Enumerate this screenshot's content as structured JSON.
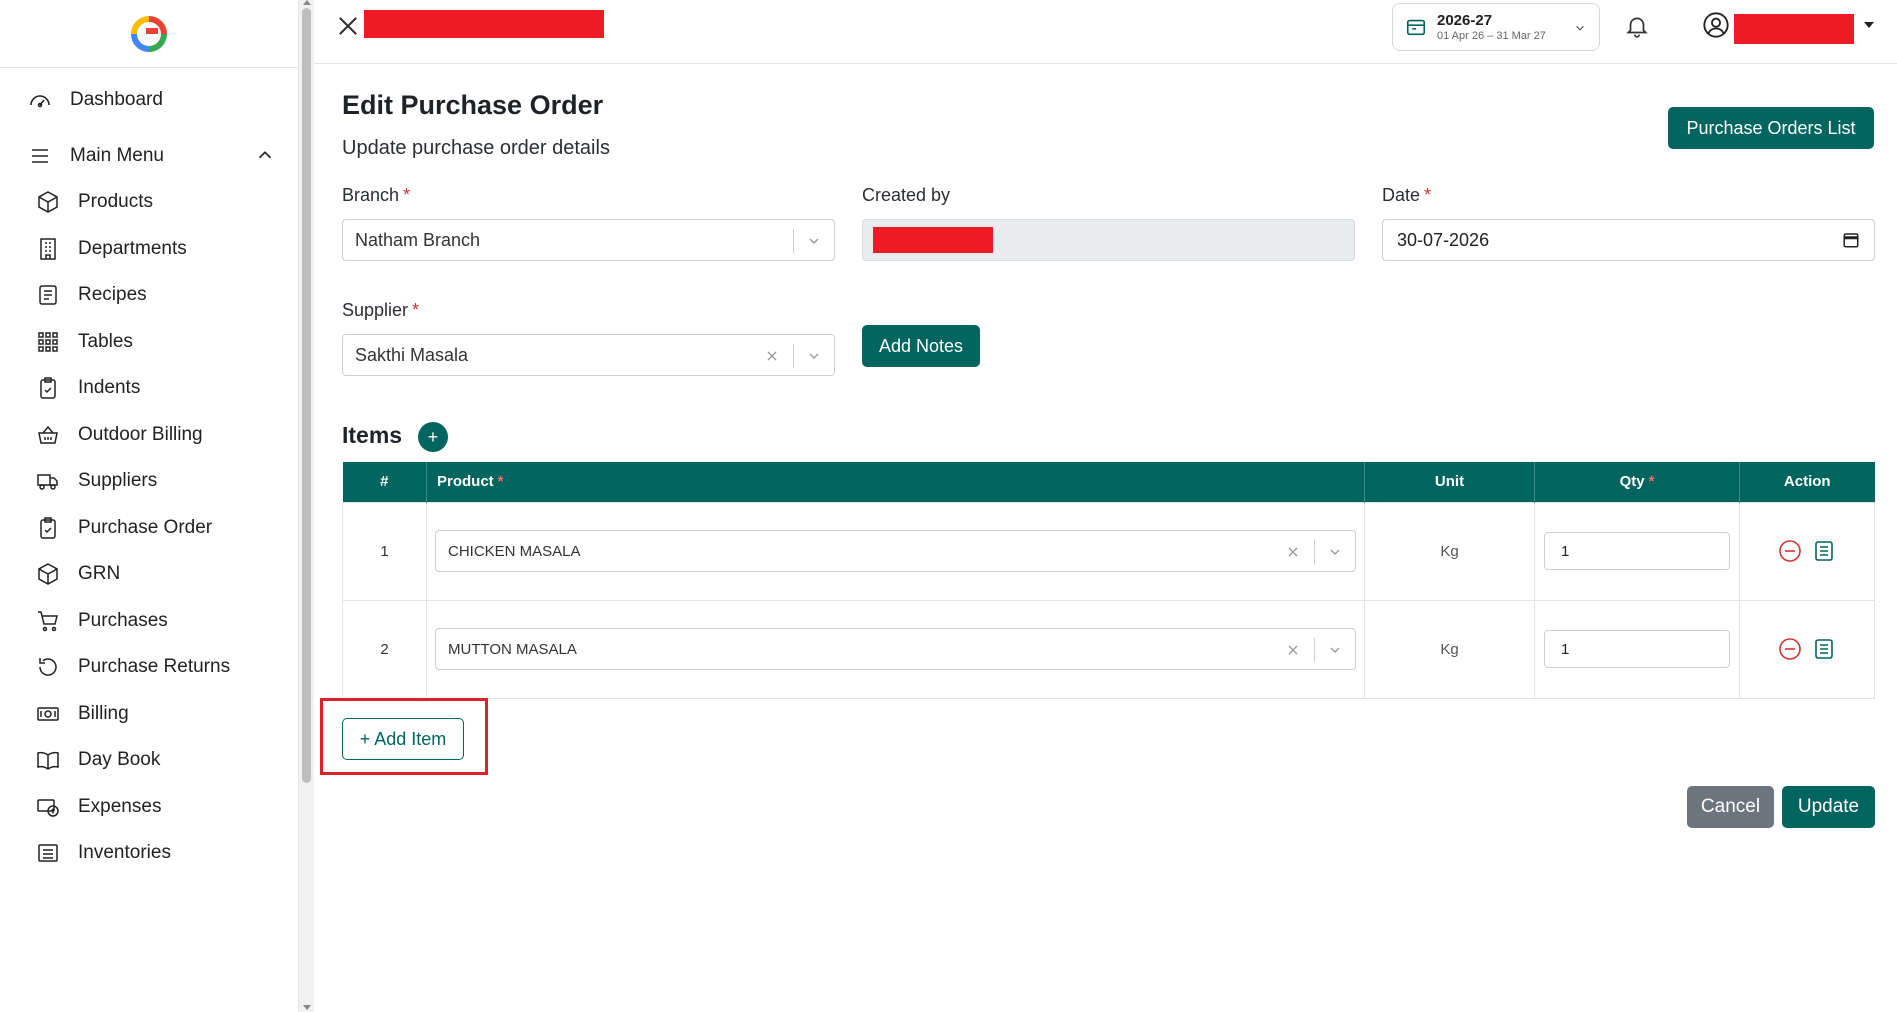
{
  "sidebar": {
    "dashboard": "Dashboard",
    "main_menu": "Main Menu",
    "items": [
      {
        "label": "Products",
        "icon": "box-icon"
      },
      {
        "label": "Departments",
        "icon": "building-icon"
      },
      {
        "label": "Recipes",
        "icon": "recipe-list-icon"
      },
      {
        "label": "Tables",
        "icon": "grid-icon"
      },
      {
        "label": "Indents",
        "icon": "clipboard-check-icon"
      },
      {
        "label": "Outdoor Billing",
        "icon": "basket-icon"
      },
      {
        "label": "Suppliers",
        "icon": "truck-icon"
      },
      {
        "label": "Purchase Order",
        "icon": "clipboard-check-icon"
      },
      {
        "label": "GRN",
        "icon": "box-icon"
      },
      {
        "label": "Purchases",
        "icon": "cart-icon"
      },
      {
        "label": "Purchase Returns",
        "icon": "return-icon"
      },
      {
        "label": "Billing",
        "icon": "cash-icon"
      },
      {
        "label": "Day Book",
        "icon": "book-icon"
      },
      {
        "label": "Expenses",
        "icon": "money-icon"
      },
      {
        "label": "Inventories",
        "icon": "list-icon"
      }
    ]
  },
  "topbar": {
    "fiscal_year": "2026-27",
    "fiscal_range": "01 Apr 26 – 31 Mar 27"
  },
  "page": {
    "title": "Edit Purchase Order",
    "subtitle": "Update purchase order details",
    "list_button": "Purchase Orders List"
  },
  "form": {
    "branch_label": "Branch",
    "branch_value": "Natham Branch",
    "created_by_label": "Created by",
    "date_label": "Date",
    "date_value": "30-07-2026",
    "supplier_label": "Supplier",
    "supplier_value": "Sakthi Masala",
    "add_notes": "Add Notes",
    "required_mark": "*"
  },
  "items": {
    "title": "Items",
    "add_icon_label": "+",
    "columns": {
      "num": "#",
      "product": "Product",
      "unit": "Unit",
      "qty": "Qty",
      "action": "Action"
    },
    "rows": [
      {
        "num": "1",
        "product": "CHICKEN MASALA",
        "unit": "Kg",
        "qty": "1"
      },
      {
        "num": "2",
        "product": "MUTTON MASALA",
        "unit": "Kg",
        "qty": "1"
      }
    ],
    "add_item_button": "+ Add Item"
  },
  "actions": {
    "cancel": "Cancel",
    "update": "Update"
  },
  "colors": {
    "primary": "#00655f",
    "danger": "#d63333",
    "redact": "#ee1b24",
    "highlight": "#e0202b",
    "secondary": "#6c757d"
  }
}
